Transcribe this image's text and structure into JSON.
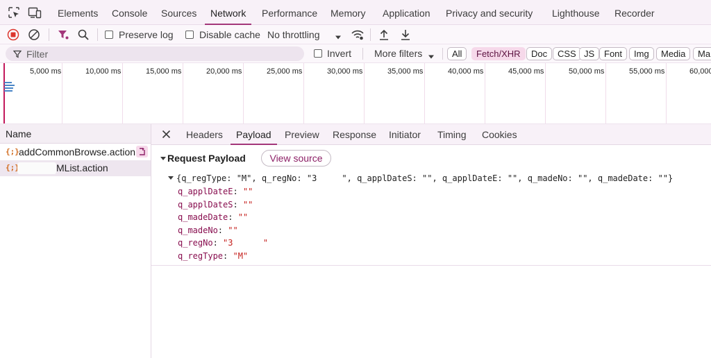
{
  "main_tabs": [
    {
      "label": "Elements",
      "active": false
    },
    {
      "label": "Console",
      "active": false
    },
    {
      "label": "Sources",
      "active": false
    },
    {
      "label": "Network",
      "active": true
    },
    {
      "label": "Performance",
      "active": false
    },
    {
      "label": "Memory",
      "active": false
    },
    {
      "label": "Application",
      "active": false
    },
    {
      "label": "Privacy and security",
      "active": false
    },
    {
      "label": "Lighthouse",
      "active": false
    },
    {
      "label": "Recorder",
      "active": false
    }
  ],
  "toolbar": {
    "preserve_log": "Preserve log",
    "disable_cache": "Disable cache",
    "throttling": "No throttling"
  },
  "filter": {
    "placeholder": "Filter",
    "invert": "Invert",
    "more_filters": "More filters",
    "types": [
      {
        "label": "All",
        "active": false
      },
      {
        "label": "Fetch/XHR",
        "active": true
      },
      {
        "label": "Doc",
        "active": false
      },
      {
        "label": "CSS",
        "active": false
      },
      {
        "label": "JS",
        "active": false
      },
      {
        "label": "Font",
        "active": false
      },
      {
        "label": "Img",
        "active": false
      },
      {
        "label": "Media",
        "active": false
      },
      {
        "label": "Ma",
        "active": false
      }
    ]
  },
  "overview": {
    "ticks": [
      "5,000 ms",
      "10,000 ms",
      "15,000 ms",
      "20,000 ms",
      "25,000 ms",
      "30,000 ms",
      "35,000 ms",
      "40,000 ms",
      "45,000 ms",
      "50,000 ms",
      "55,000 ms",
      "60,000"
    ]
  },
  "request_list": {
    "header": "Name",
    "items": [
      {
        "icon": "{;}",
        "name": "addCommonBrowse.action",
        "selected": false
      },
      {
        "icon": "{;}",
        "name": "MList.action",
        "selected": true
      }
    ]
  },
  "detail": {
    "tabs": [
      {
        "label": "Headers",
        "active": false
      },
      {
        "label": "Payload",
        "active": true
      },
      {
        "label": "Preview",
        "active": false
      },
      {
        "label": "Response",
        "active": false
      },
      {
        "label": "Initiator",
        "active": false
      },
      {
        "label": "Timing",
        "active": false
      },
      {
        "label": "Cookies",
        "active": false
      }
    ],
    "section_title": "Request Payload",
    "view_source": "View source",
    "summary": "{q_regType: \"M\", q_regNo: \"3     \", q_applDateS: \"\", q_applDateE: \"\", q_madeNo: \"\", q_madeDate: \"\"}",
    "properties": [
      {
        "key": "q_applDateE",
        "value": "\"\""
      },
      {
        "key": "q_applDateS",
        "value": "\"\""
      },
      {
        "key": "q_madeDate",
        "value": "\"\""
      },
      {
        "key": "q_madeNo",
        "value": "\"\""
      },
      {
        "key": "q_regNo",
        "value": "\"3      \""
      },
      {
        "key": "q_regType",
        "value": "\"M\""
      }
    ]
  }
}
